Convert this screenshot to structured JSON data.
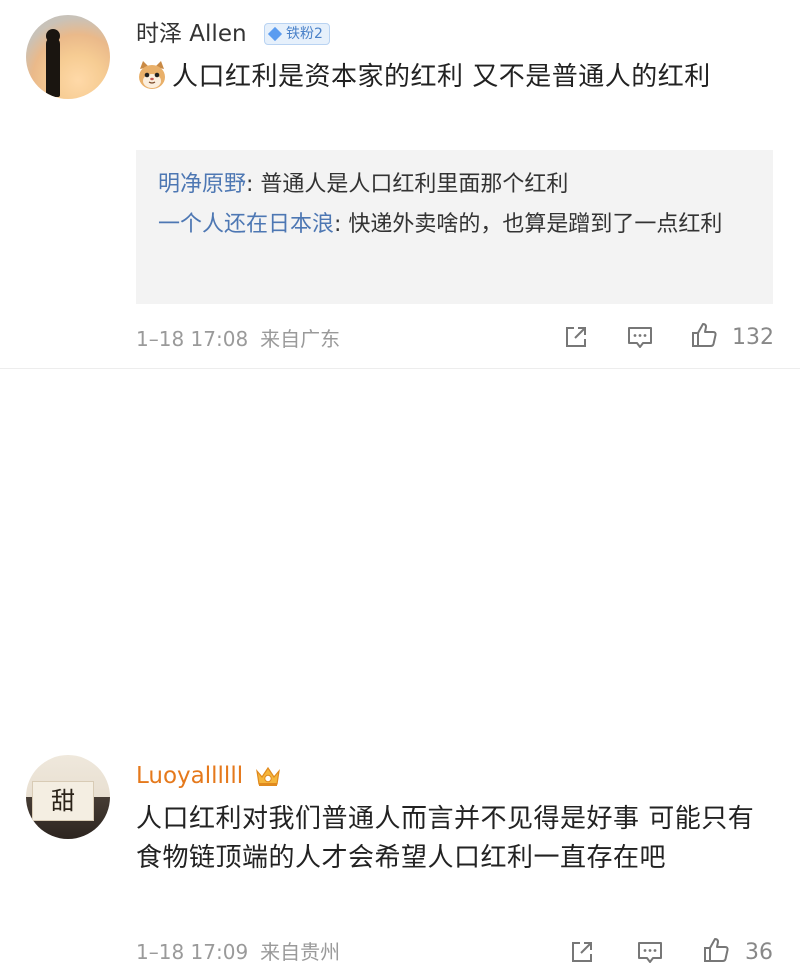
{
  "comments": [
    {
      "username": "时泽 Allen",
      "badge": "铁粉2",
      "emoji": "cat-face-emoji",
      "text": "人口红利是资本家的红利 又不是普通人的红利",
      "replies": [
        {
          "name": "明净原野",
          "text": ": 普通人是人口红利里面那个红利"
        },
        {
          "name": "一个人还在日本浪",
          "text": ": 快递外卖啥的，也算是蹭到了一点红利"
        }
      ],
      "date": "1–18 17:08",
      "location": "来自广东",
      "likes": "132"
    },
    {
      "username": "Luoyallllll",
      "avatar_glyph": "甜",
      "crown": "crown-icon",
      "text": "人口红利对我们普通人而言并不见得是好事 可能只有食物链顶端的人才会希望人口红利一直存在吧",
      "date": "1–18 17:09",
      "location": "来自贵州",
      "likes": "36"
    }
  ],
  "icons": [
    "share-icon",
    "comment-icon",
    "like-icon"
  ],
  "colors": {
    "vip_name": "#e5791c",
    "reply_name": "#4d77b3",
    "badge_bg": "#e6f0fb",
    "reply_bg": "#f3f3f3",
    "meta": "#9a9a9a"
  }
}
